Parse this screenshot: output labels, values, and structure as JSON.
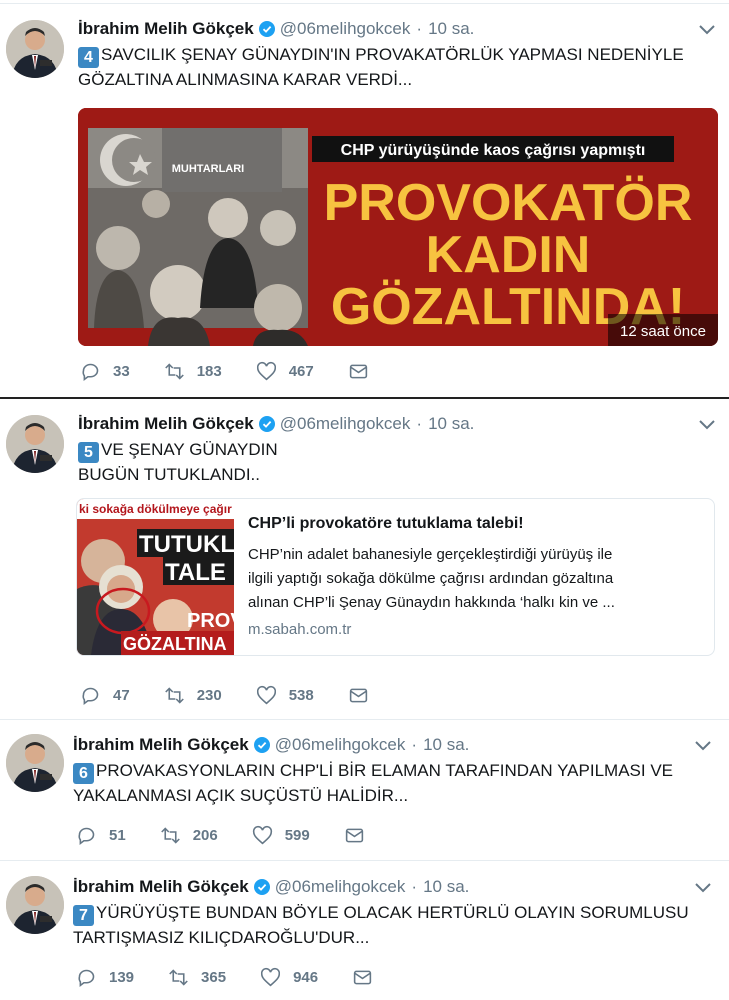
{
  "tweets": [
    {
      "author": "İbrahim Melih Gökçek",
      "handle": "@06melihgokcek",
      "sep": "·",
      "time": "10 sa.",
      "num": "4",
      "lines": [
        "SAVCILIK ŞENAY GÜNAYDIN'IN PROVAKATÖRLÜK YAPMASI NEDENİYLE",
        "GÖZALTINA ALINMASINA KARAR VERDİ..."
      ],
      "replies": "33",
      "retweets": "183",
      "likes": "467",
      "media": {
        "banner": "CHP yürüyüşünde kaos çağrısı yapmıştı",
        "headline": [
          "PROVOKATÖR",
          "KADIN",
          "GÖZALTINDA!"
        ],
        "sign": "MUHTARLARI",
        "badge": "12 saat önce"
      }
    },
    {
      "author": "İbrahim Melih Gökçek",
      "handle": "@06melihgokcek",
      "sep": "·",
      "time": "10 sa.",
      "num": "5",
      "lines": [
        "VE ŞENAY GÜNAYDIN",
        "BUGÜN TUTUKLANDI.."
      ],
      "replies": "47",
      "retweets": "230",
      "likes": "538",
      "card": {
        "title": "CHP’li provokatöre tutuklama talebi!",
        "desc": [
          "CHP’nin adalet bahanesiyle gerçekleştirdiği yürüyüş ile",
          "ilgili yaptığı sokağa dökülme çağrısı ardından gözaltına",
          "alınan CHP’li Şenay Günaydın hakkında ‘halkı kin ve ..."
        ],
        "domain": "m.sabah.com.tr",
        "thumb": [
          "ki sokağa dökülmeye çağır",
          "TUTUKL",
          "TALE",
          "PROV",
          "GÖZALTINA"
        ]
      }
    },
    {
      "author": "İbrahim Melih Gökçek",
      "handle": "@06melihgokcek",
      "sep": "·",
      "time": "10 sa.",
      "num": "6",
      "lines": [
        "PROVAKASYONLARIN CHP'Lİ BİR ELAMAN TARAFINDAN YAPILMASI VE",
        "YAKALANMASI AÇIK SUÇÜSTÜ HALİDİR..."
      ],
      "replies": "51",
      "retweets": "206",
      "likes": "599"
    },
    {
      "author": "İbrahim Melih Gökçek",
      "handle": "@06melihgokcek",
      "sep": "·",
      "time": "10 sa.",
      "num": "7",
      "lines": [
        "YÜRÜYÜŞTE BUNDAN BÖYLE OLACAK HERTÜRLÜ OLAYIN SORUMLUSU",
        "TARTIŞMASIZ KILIÇDAROĞLU'DUR..."
      ],
      "replies": "139",
      "retweets": "365",
      "likes": "946"
    }
  ],
  "colors": {
    "accent": "#1da1f2",
    "muted": "#657786",
    "keycap": "#3b88c3",
    "media_red": "#9e1a15",
    "headline_gold": "#f7c340"
  },
  "icons": [
    "verified-icon",
    "chevron-down-icon",
    "reply-icon",
    "retweet-icon",
    "like-icon",
    "dm-icon"
  ]
}
